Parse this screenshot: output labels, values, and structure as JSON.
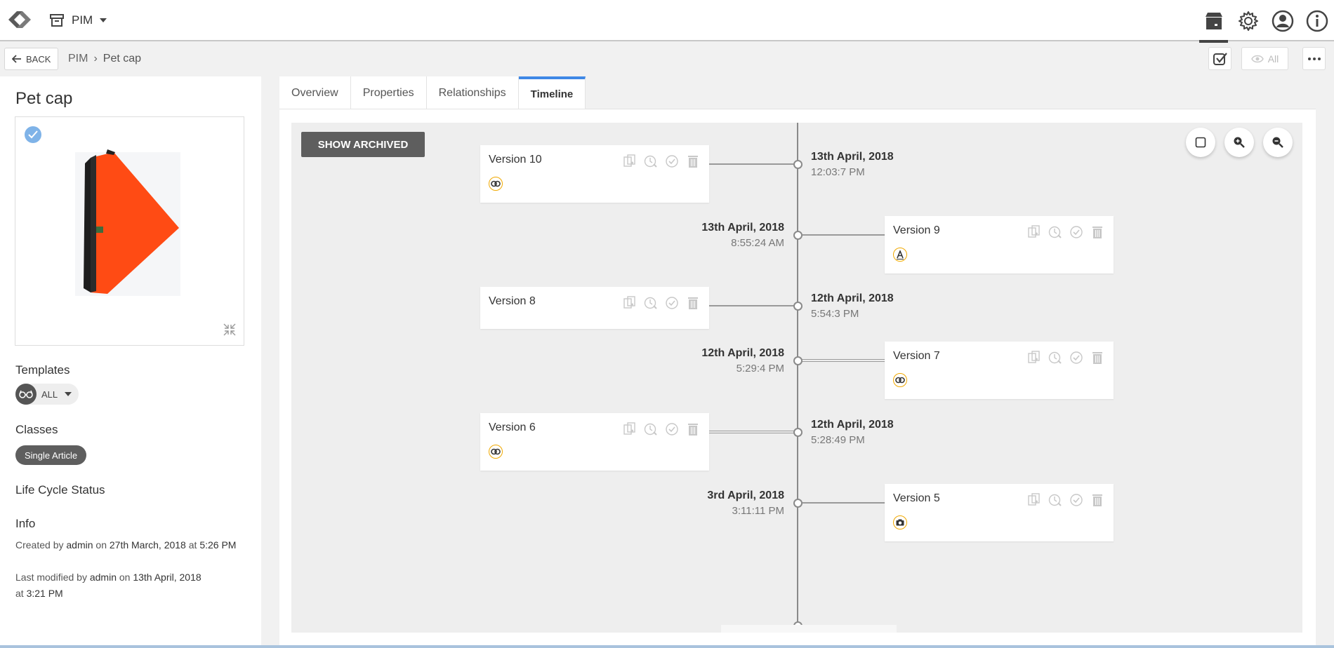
{
  "app": {
    "module": "PIM"
  },
  "breadcrumb": {
    "back_label": "BACK",
    "root": "PIM",
    "separator": "›",
    "current": "Pet cap",
    "view_all_label": "All"
  },
  "product": {
    "title": "Pet cap",
    "templates_label": "Templates",
    "templates_value": "ALL",
    "classes_label": "Classes",
    "class_chip": "Single Article",
    "lifecycle_label": "Life Cycle Status",
    "info_label": "Info",
    "info": {
      "created_prefix": "Created by",
      "created_by": "admin",
      "created_on_word": "on",
      "created_date": "27th March, 2018",
      "created_at_word": "at",
      "created_time": "5:26 PM",
      "modified_prefix": "Last modified by",
      "modified_by": "admin",
      "modified_on_word": "on",
      "modified_date": "13th April, 2018",
      "modified_at_word": "at",
      "modified_time": "3:21 PM"
    }
  },
  "tabs": [
    "Overview",
    "Properties",
    "Relationships",
    "Timeline"
  ],
  "active_tab": "Timeline",
  "timeline": {
    "show_archived_label": "SHOW ARCHIVED",
    "versions": [
      {
        "label": "Version 10",
        "date": "13th April, 2018",
        "time": "12:03:7 PM",
        "side": "left",
        "badge": "link"
      },
      {
        "label": "Version 9",
        "date": "13th April, 2018",
        "time": "8:55:24 AM",
        "side": "right",
        "badge": "A"
      },
      {
        "label": "Version 8",
        "date": "12th April, 2018",
        "time": "5:54:3 PM",
        "side": "left",
        "badge": ""
      },
      {
        "label": "Version 7",
        "date": "12th April, 2018",
        "time": "5:29:4 PM",
        "side": "right",
        "badge": "link"
      },
      {
        "label": "Version 6",
        "date": "12th April, 2018",
        "time": "5:28:49 PM",
        "side": "left",
        "badge": "link"
      },
      {
        "label": "Version 5",
        "date": "3rd April, 2018",
        "time": "3:11:11 PM",
        "side": "right",
        "badge": "camera"
      }
    ]
  },
  "colors": {
    "accent": "#3f88e6",
    "badge": "#f0a800",
    "product_image": "#ff4b14"
  }
}
